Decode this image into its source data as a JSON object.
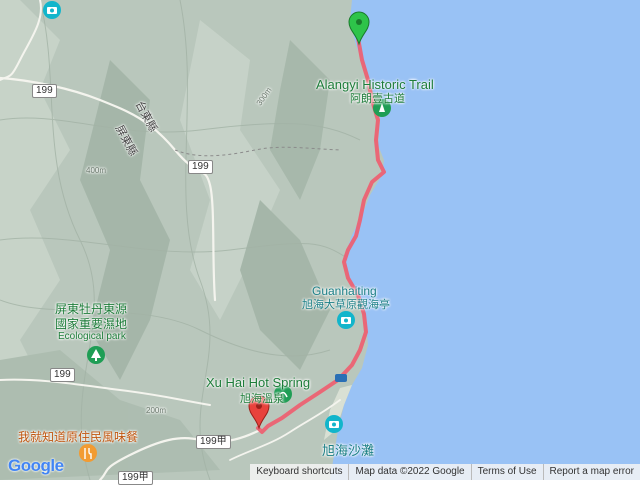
{
  "colors": {
    "sea": "#99c2f5",
    "terrain": "#b9c7bc",
    "route": "#ef5c6e",
    "start_pin": "#2ec44a",
    "end_pin": "#e8423c"
  },
  "labels": {
    "alangyi_en": "Alangyi Historic Trail",
    "alangyi_zh": "阿朗壹古道",
    "guanhaiting_en": "Guanhaiting",
    "guanhaiting_zh": "旭海大草原觀海亭",
    "ecopark_zh1": "屏東牡丹東源",
    "ecopark_zh2": "國家重要濕地",
    "ecopark_en": "Ecological park",
    "hotspring_en": "Xu Hai Hot Spring",
    "hotspring_zh": "旭海溫泉",
    "beach_zh": "旭海沙灘",
    "restaurant_zh": "我就知道原住民風味餐",
    "taitung_county": "台東縣",
    "pingtung_county": "屏東縣"
  },
  "roads": {
    "r199_a": "199",
    "r199_b": "199",
    "r199_c": "199",
    "r199jia_a": "199甲",
    "r199jia_b": "199甲"
  },
  "contours": {
    "c300": "300m",
    "c400": "400m",
    "c200": "200m"
  },
  "brand": "Google",
  "attribution": {
    "shortcuts": "Keyboard shortcuts",
    "mapdata": "Map data ©2022 Google",
    "terms": "Terms of Use",
    "report": "Report a map error"
  }
}
